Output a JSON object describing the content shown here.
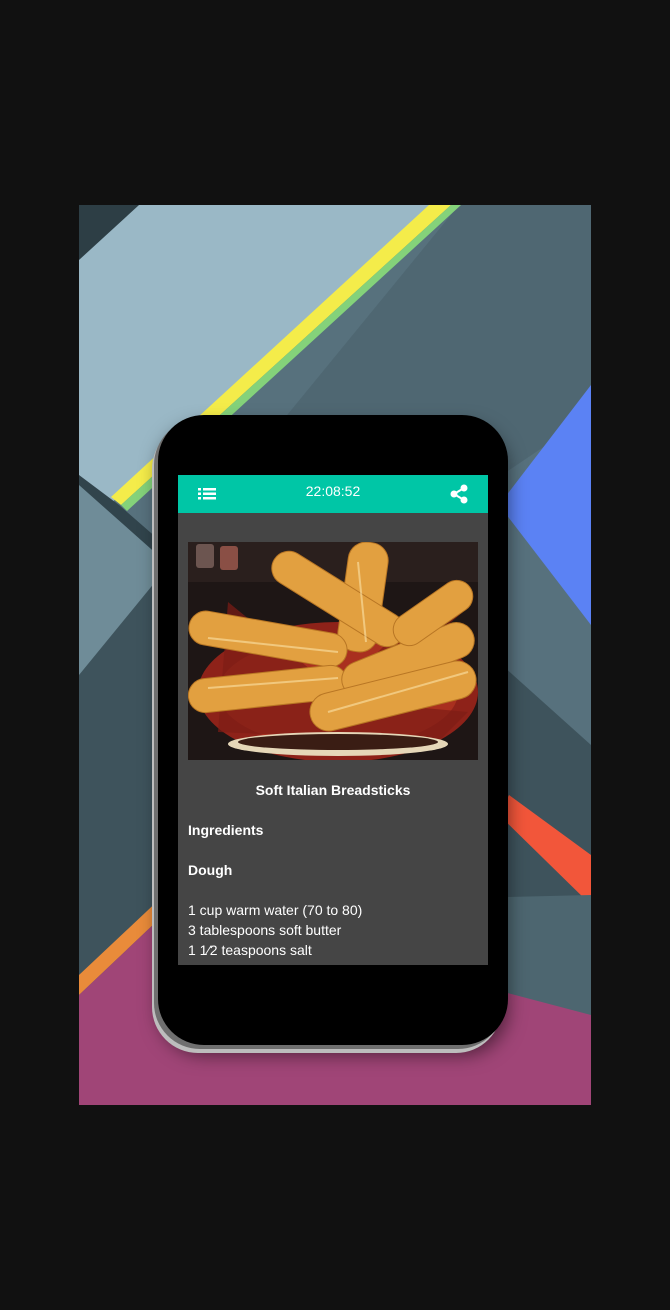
{
  "status_bar": {
    "time": "22:08:52"
  },
  "toolbar": {
    "menu_icon": "list-menu-icon",
    "share_icon": "share-icon",
    "accent_color": "#00c6a6"
  },
  "recipe": {
    "title": "Soft Italian Breadsticks",
    "section_heading": "Ingredients",
    "subsection_heading": "Dough",
    "ingredients": [
      "1 cup warm water (70 to 80)",
      "3 tablespoons soft butter",
      "1 1⁄2 teaspoons salt"
    ]
  }
}
